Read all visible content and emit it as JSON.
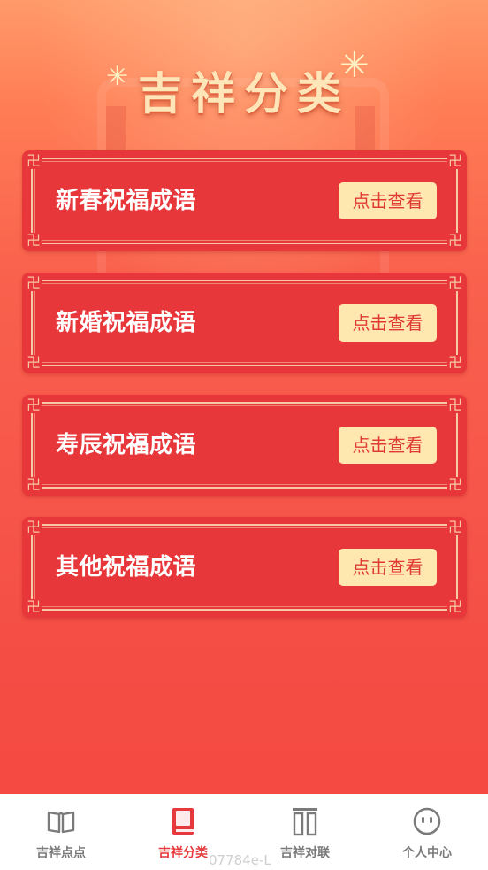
{
  "page": {
    "title": "吉祥分类"
  },
  "categories": [
    {
      "label": "新春祝福成语",
      "button": "点击查看"
    },
    {
      "label": "新婚祝福成语",
      "button": "点击查看"
    },
    {
      "label": "寿辰祝福成语",
      "button": "点击查看"
    },
    {
      "label": "其他祝福成语",
      "button": "点击查看"
    }
  ],
  "tabbar": {
    "tabs": [
      {
        "label": "吉祥点点",
        "icon": "open-book-icon",
        "active": false
      },
      {
        "label": "吉祥分类",
        "icon": "book-icon",
        "active": true
      },
      {
        "label": "吉祥对联",
        "icon": "couplet-icon",
        "active": false
      },
      {
        "label": "个人中心",
        "icon": "smiley-face-icon",
        "active": false
      }
    ]
  },
  "watermark": "07784e-L",
  "colors": {
    "card_red": "#e8373a",
    "button_cream": "#ffe7b0",
    "active_tab": "#e5393b",
    "inactive_tab": "#7a7a7a"
  }
}
